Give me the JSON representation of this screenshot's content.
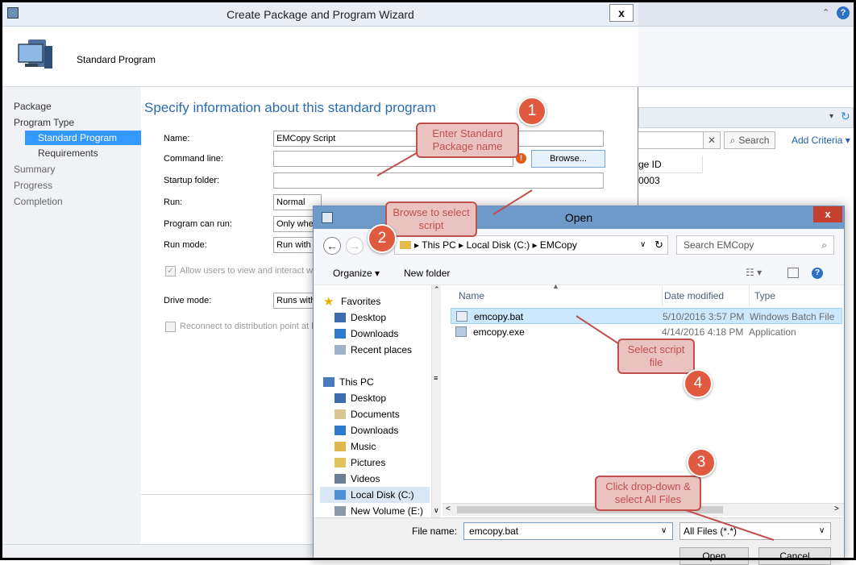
{
  "background": {
    "search_label": "Search",
    "add_criteria_label": "Add Criteria ▾",
    "column_fragment": "ge ID",
    "row_fragment": "0003"
  },
  "wizard": {
    "title": "Create Package and Program Wizard",
    "close_label": "x",
    "header_title": "Standard Program",
    "nav": [
      "Package",
      "Program Type",
      "Standard Program",
      "Requirements",
      "Summary",
      "Progress",
      "Completion"
    ],
    "heading": "Specify information about this standard program",
    "fields": {
      "name_label": "Name:",
      "name_value": "EMCopy Script",
      "cmd_label": "Command line:",
      "cmd_value": "",
      "browse_label": "Browse...",
      "startup_label": "Startup folder:",
      "run_label": "Run:",
      "run_value": "Normal",
      "canrun_label": "Program can run:",
      "canrun_value": "Only wher",
      "runmode_label": "Run mode:",
      "runmode_value": "Run with u",
      "allow_label": "Allow users to view and interact with",
      "drivemode_label": "Drive mode:",
      "drivemode_value": "Runs with",
      "reconnect_label": "Reconnect to distribution point at log"
    }
  },
  "open_dialog": {
    "title": "Open",
    "close_label": "x",
    "breadcrumb": "▸ This PC ▸ Local Disk (C:) ▸ EMCopy",
    "search_placeholder": "Search EMCopy",
    "organize_label": "Organize ▾",
    "new_folder_label": "New folder",
    "tree": {
      "favorites": "Favorites",
      "fav_items": [
        "Desktop",
        "Downloads",
        "Recent places"
      ],
      "this_pc": "This PC",
      "pc_items": [
        "Desktop",
        "Documents",
        "Downloads",
        "Music",
        "Pictures",
        "Videos",
        "Local Disk (C:)",
        "New Volume (E:)"
      ]
    },
    "columns": {
      "name": "Name",
      "date": "Date modified",
      "type": "Type"
    },
    "files": [
      {
        "name": "emcopy.bat",
        "date": "5/10/2016 3:57 PM",
        "type": "Windows Batch File"
      },
      {
        "name": "emcopy.exe",
        "date": "4/14/2016 4:18 PM",
        "type": "Application"
      }
    ],
    "file_name_label": "File name:",
    "file_name_value": "emcopy.bat",
    "filter_value": "All Files (*.*)",
    "open_label": "Open",
    "cancel_label": "Cancel"
  },
  "callouts": {
    "c1": "Enter Standard Package name",
    "c2": "Browse to select script",
    "c3": "Click drop-down & select All Files",
    "c4": "Select script file",
    "b1": "1",
    "b2": "2",
    "b3": "3",
    "b4": "4"
  },
  "colors": {
    "accent": "#3399ff",
    "callout_fill": "#eac3c1",
    "callout_border": "#c0504d",
    "badge": "#e05a3f"
  }
}
